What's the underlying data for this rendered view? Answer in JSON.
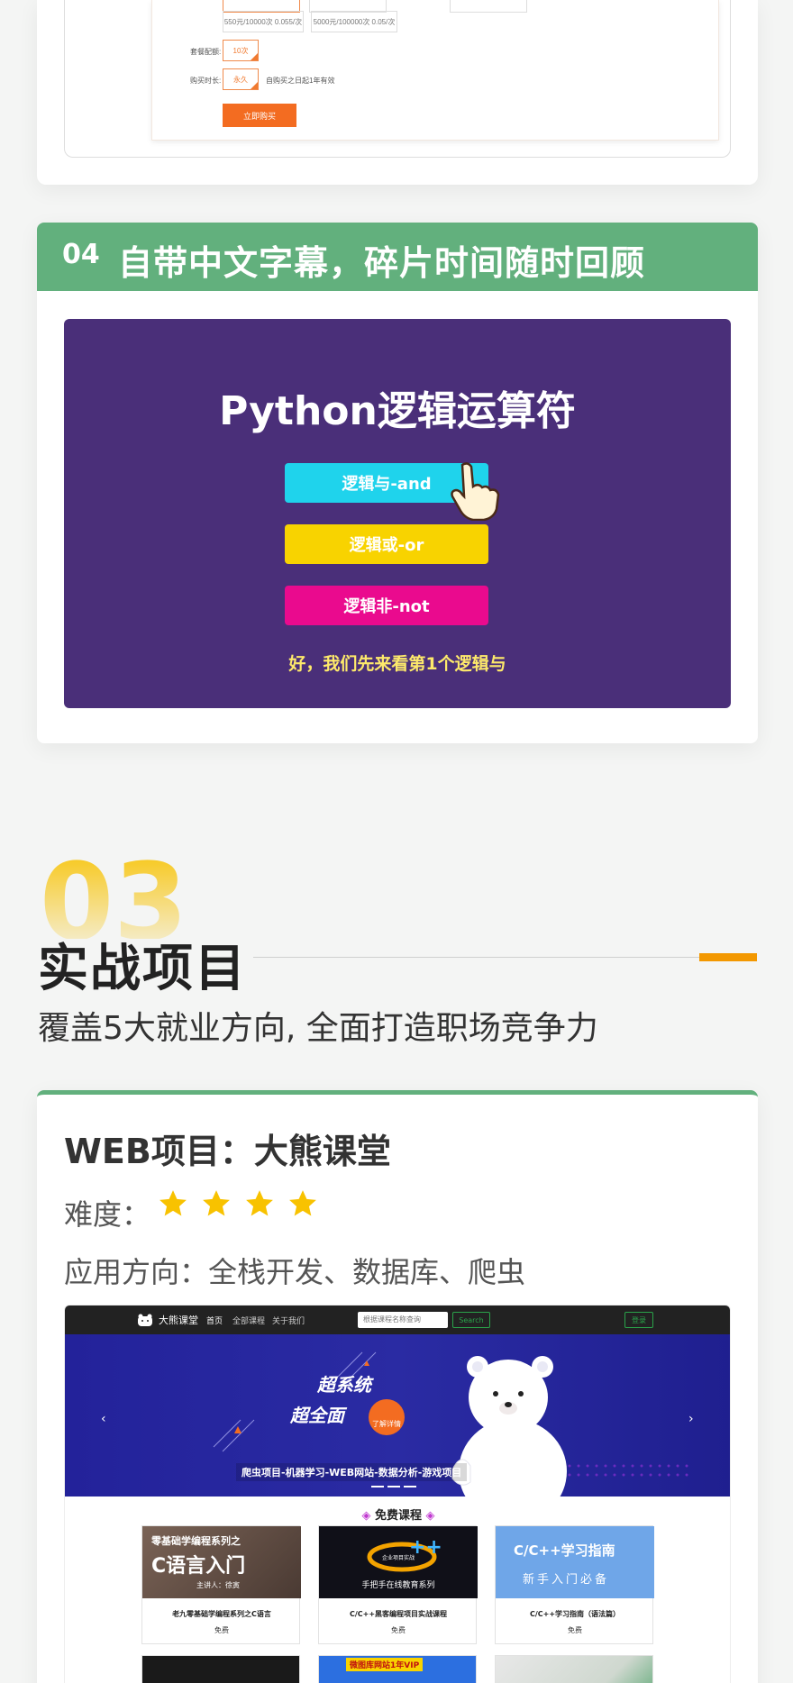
{
  "purchase": {
    "tiers": [
      "550元/10000次 0.055/次",
      "5000元/100000次 0.05/次"
    ],
    "package_label": "套餐配额:",
    "package_value": "10次",
    "duration_label": "购买时长:",
    "duration_value": "永久",
    "duration_note": "自购买之日起1年有效",
    "buy_button": "立即购买"
  },
  "feature": {
    "number": "04",
    "title": "自带中文字幕，碎片时间随时回顾",
    "video": {
      "title": "Python逻辑运算符",
      "buttons": [
        {
          "label": "逻辑与-and",
          "color": "#1fd3ec"
        },
        {
          "label": "逻辑或-or",
          "color": "#f8d300"
        },
        {
          "label": "逻辑非-not",
          "color": "#ea0a8e"
        }
      ],
      "caption": "好，我们先来看第1个逻辑与"
    }
  },
  "section": {
    "number": "03",
    "title": "实战项目",
    "subtitle": "覆盖5大就业方向, 全面打造职场竞争力",
    "accent": "#f39800"
  },
  "project": {
    "name": "WEB项目：大熊课堂",
    "difficulty_label": "难度：",
    "stars": 4,
    "application": "应用方向：全栈开发、数据库、爬虫",
    "site": {
      "logo": "大熊课堂",
      "nav": [
        "首页",
        "全部课程",
        "关于我们"
      ],
      "search_placeholder": "根据课程名称查询",
      "search_button": "Search",
      "login": "登录",
      "banner_line1": "超系统",
      "banner_line2": "超全面",
      "banner_button": "了解详情",
      "banner_strip": "爬虫项目-机器学习-WEB网站-数据分析-游戏项目",
      "free_title": "免费课程",
      "courses": [
        {
          "title": "老九零基础学编程系列之C语言",
          "price": "免费",
          "thumb_text1": "零基础学编程系列之",
          "thumb_text2": "C语言入门",
          "thumb_text3": "主讲人：徐寅"
        },
        {
          "title": "C/C++黑客编程项目实战课程",
          "price": "免费",
          "thumb_text1": "企业项目实战",
          "thumb_text2": "手把手在线教育系列"
        },
        {
          "title": "C/C++学习指南（语法篇）",
          "price": "免费",
          "thumb_text1": "C/C++学习指南",
          "thumb_text2": "新手入门必备"
        }
      ],
      "next_row_text": "微图库网站1年VIP"
    }
  }
}
